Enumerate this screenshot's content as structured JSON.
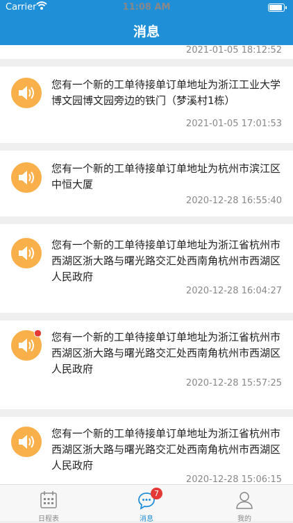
{
  "status_bar": {
    "carrier": "Carrier",
    "time": "11:08 AM"
  },
  "header": {
    "title": "消息"
  },
  "messages": [
    {
      "text": "",
      "time": "2021-01-05 18:12:52"
    },
    {
      "text": "您有一个新的工单待接单订单地址为浙江工业大学博文园博文园旁边的铁门（梦溪村1栋）",
      "time": "2021-01-05 17:01:53"
    },
    {
      "text": "您有一个新的工单待接单订单地址为杭州市滨江区中恒大厦",
      "time": "2020-12-28 16:55:40"
    },
    {
      "text": "您有一个新的工单待接单订单地址为浙江省杭州市西湖区浙大路与曙光路交汇处西南角杭州市西湖区人民政府",
      "time": "2020-12-28 16:04:27"
    },
    {
      "text": "您有一个新的工单待接单订单地址为浙江省杭州市西湖区浙大路与曙光路交汇处西南角杭州市西湖区人民政府",
      "time": "2020-12-28 15:57:25",
      "unread": true
    },
    {
      "text": "您有一个新的工单待接单订单地址为浙江省杭州市西湖区浙大路与曙光路交汇处西南角杭州市西湖区人民政府",
      "time": "2020-12-28 15:06:15"
    }
  ],
  "tabbar": {
    "schedule": "日程表",
    "messages": "消息",
    "messages_badge": "7",
    "mine": "我的"
  },
  "colors": {
    "primary": "#1f8fd8",
    "avatar": "#f9b04a",
    "badge": "#e53935"
  }
}
